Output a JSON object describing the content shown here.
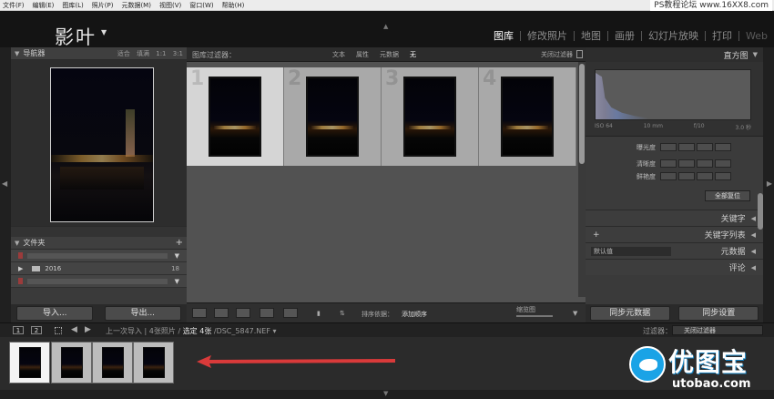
{
  "menu": [
    "文件(F)",
    "编辑(E)",
    "图库(L)",
    "照片(P)",
    "元数据(M)",
    "视图(V)",
    "窗口(W)",
    "帮助(H)"
  ],
  "watermark_top": "PS教程论坛 www.16XX8.com",
  "identity_plate": "影叶",
  "modules": [
    "图库",
    "修改照片",
    "地图",
    "画册",
    "幻灯片放映",
    "打印",
    "Web"
  ],
  "active_module": "图库",
  "navigator": {
    "title": "导航器",
    "options": [
      "适合",
      "填满",
      "1:1",
      "3:1"
    ]
  },
  "folders": {
    "title": "文件夹",
    "items": [
      {
        "name": "2016",
        "count": "18"
      }
    ]
  },
  "left_buttons": {
    "import": "导入...",
    "export": "导出..."
  },
  "filter_bar": {
    "label": "图库过滤器：",
    "tabs": [
      "文本",
      "属性",
      "元数据",
      "无"
    ],
    "active_tab": "无",
    "close_filter": "关闭过滤器"
  },
  "grid": {
    "cells": [
      {
        "index": "1",
        "selected": true
      },
      {
        "index": "2",
        "selected": false
      },
      {
        "index": "3",
        "selected": false
      },
      {
        "index": "4",
        "selected": false
      }
    ]
  },
  "toolbar": {
    "sort_label": "排序依据：",
    "sort_value": "添加顺序",
    "thumbnails_label": "缩览图"
  },
  "right_panel": {
    "histogram_title": "直方图",
    "histogram_info": [
      "ISO 64",
      "10 mm",
      "f/10",
      "3.0 秒"
    ],
    "quick_develop": {
      "rows": [
        "曝光度",
        "清晰度",
        "鲜艳度"
      ],
      "reset_all": "全部复位"
    },
    "sections": {
      "keywords": "关键字",
      "keyword_list": "关键字列表",
      "metadata": "元数据",
      "metadata_preset": "默认值",
      "comments": "评论"
    },
    "buttons": {
      "sync_metadata": "同步元数据",
      "sync_settings": "同步设置"
    }
  },
  "filmstrip_bar": {
    "page1": "1",
    "page2": "2",
    "crumb_prev": "上一次导入",
    "crumb_photos": "4张照片",
    "crumb_selected": "选定 4张",
    "crumb_file": "/DSC_5847.NEF",
    "filter_label": "过滤器：",
    "filter_value": "关闭过滤器"
  },
  "filmstrip": {
    "count": 4
  },
  "brand": {
    "cn": "优图宝",
    "en": "utobao.com"
  },
  "colors": {
    "accent_arrow": "#d93a3a",
    "brand_blue": "#1aa3e6"
  }
}
